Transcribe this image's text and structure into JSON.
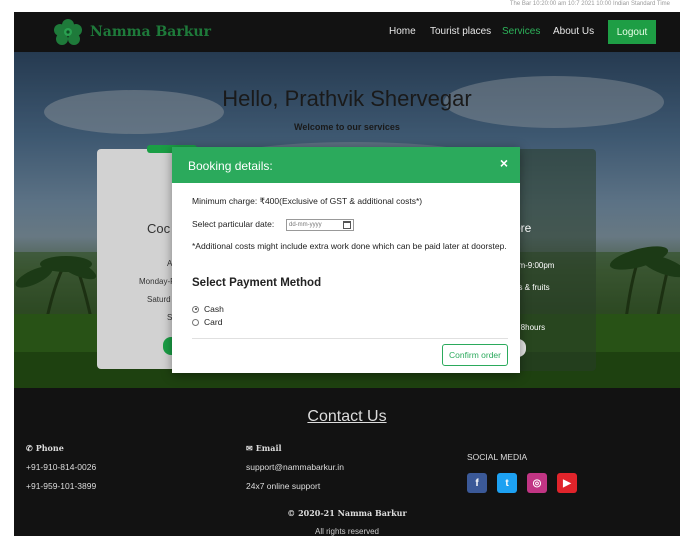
{
  "top_strip": {
    "text": "The Bar 10:20:00 am 10:7 2021 10:00 Indian Standard Time"
  },
  "nav": {
    "brand": "Namma Barkur",
    "links": [
      "Home",
      "Tourist places",
      "Services",
      "About Us"
    ],
    "active_link": "Services",
    "logout_label": "Logout",
    "colors": {
      "background": "#121212",
      "accent": "#1e9e45",
      "active": "#2db35a"
    }
  },
  "hero": {
    "greeting": "Hello, Prathvik Shervegar",
    "subtitle": "Welcome to our services"
  },
  "card_left": {
    "title": "Coc",
    "lines": [
      "A",
      "Monday-F",
      "Saturd",
      "S"
    ]
  },
  "card_right": {
    "title": "ore",
    "lines": [
      "am-9:00pm",
      "es & fruits",
      "n 8hours"
    ]
  },
  "modal": {
    "title": "Booking details:",
    "close_glyph": "×",
    "min_charge": "Minimum charge: ₹400(Exclusive of GST & additional costs*)",
    "date_label": "Select particular date:",
    "date_placeholder": "dd-mm-yyyy",
    "note": "*Additional costs might include extra work done which can be paid later at doorstep.",
    "payment_title": "Select Payment Method",
    "payment_options": [
      {
        "label": "Cash",
        "selected": true
      },
      {
        "label": "Card",
        "selected": false
      }
    ],
    "confirm_label": "Confirm order",
    "header_color": "#2baa5c"
  },
  "footer": {
    "contact_title": "Contact Us",
    "phone": {
      "heading": "Phone",
      "numbers": [
        "+91-910-814-0026",
        "+91-959-101-3899"
      ]
    },
    "email": {
      "heading": "Email",
      "address": "support@nammabarkur.in",
      "note": "24x7 online support"
    },
    "social": {
      "title": "SOCIAL MEDIA",
      "icons": [
        {
          "name": "facebook-icon",
          "glyph": "f",
          "color": "#3b5998"
        },
        {
          "name": "twitter-icon",
          "glyph": "t",
          "color": "#1da1f2"
        },
        {
          "name": "instagram-icon",
          "glyph": "◎",
          "color": "#c13584"
        },
        {
          "name": "youtube-icon",
          "glyph": "▶",
          "color": "#e0242b"
        }
      ]
    },
    "copyright": "2020-21 Namma Barkur",
    "copyright_symbol": "©",
    "rights": "All rights reserved"
  }
}
